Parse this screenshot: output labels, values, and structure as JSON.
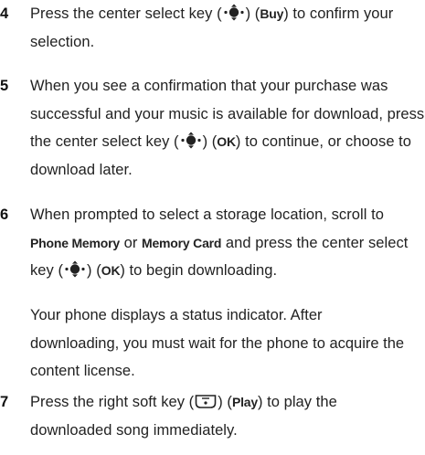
{
  "steps": [
    {
      "number": "4",
      "before": "Press the center select key (",
      "mid": ") (",
      "key_label": "Buy",
      "after": ") to confirm your selection."
    },
    {
      "number": "5",
      "before": "When you see a confirmation that your purchase was successful and your music is available for download, press the center select key (",
      "mid": ") (",
      "key_label": "OK",
      "after": ") to continue, or choose to download later."
    },
    {
      "number": "6",
      "text_a": "When prompted to select a storage location, scroll to ",
      "option1": "Phone Memory",
      "text_or": " or ",
      "option2": "Memory Card",
      "text_b": " and press the center select key (",
      "mid": ") (",
      "key_label": "OK",
      "after": ") to begin downloading.",
      "note": "Your phone displays a status indicator. After downloading, you must wait for the phone to acquire the content license."
    },
    {
      "number": "7",
      "before": "Press the right soft key (",
      "mid": ") (",
      "key_label": "Play",
      "after": ") to play the downloaded song immediately."
    }
  ],
  "icons": {
    "nav_key": "center-select-key-icon",
    "soft_key": "right-soft-key-icon"
  }
}
